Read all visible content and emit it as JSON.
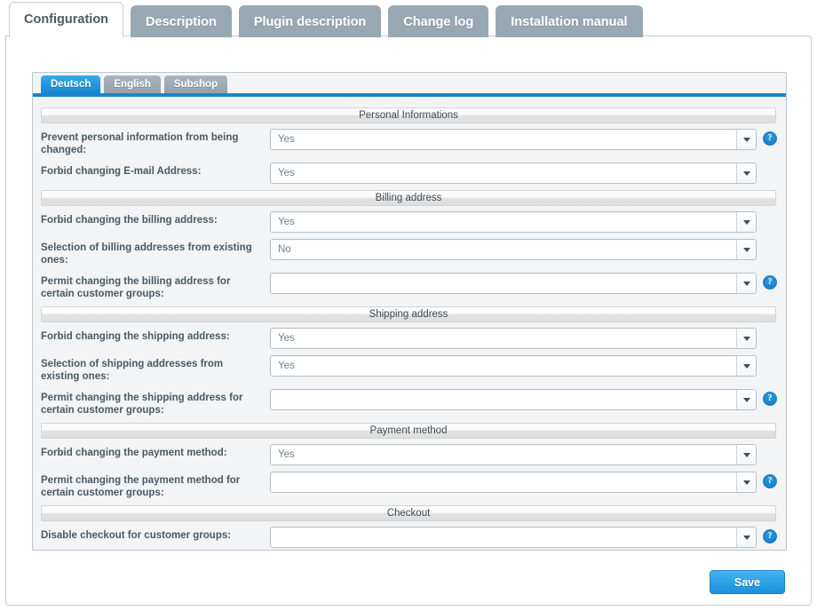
{
  "top_tabs": [
    {
      "label": "Configuration",
      "active": true
    },
    {
      "label": "Description",
      "active": false
    },
    {
      "label": "Plugin description",
      "active": false
    },
    {
      "label": "Change log",
      "active": false
    },
    {
      "label": "Installation manual",
      "active": false
    }
  ],
  "language_tabs": [
    {
      "label": "Deutsch",
      "active": true
    },
    {
      "label": "English",
      "active": false
    },
    {
      "label": "Subshop",
      "active": false
    }
  ],
  "help_glyph": "?",
  "sections": [
    {
      "title": "Personal Informations",
      "rows": [
        {
          "label": "Prevent personal information from being changed:",
          "value": "Yes",
          "help": true
        },
        {
          "label": "Forbid changing E-mail Address:",
          "value": "Yes",
          "help": false
        }
      ]
    },
    {
      "title": "Billing address",
      "rows": [
        {
          "label": "Forbid changing the billing address:",
          "value": "Yes",
          "help": false
        },
        {
          "label": "Selection of billing addresses from existing ones:",
          "value": "No",
          "help": false
        },
        {
          "label": "Permit changing the billing address for certain customer groups:",
          "value": "",
          "help": true
        }
      ]
    },
    {
      "title": "Shipping address",
      "rows": [
        {
          "label": "Forbid changing the shipping address:",
          "value": "Yes",
          "help": false
        },
        {
          "label": "Selection of shipping addresses from existing ones:",
          "value": "Yes",
          "help": false
        },
        {
          "label": "Permit changing the shipping address for certain customer groups:",
          "value": "",
          "help": true
        }
      ]
    },
    {
      "title": "Payment method",
      "rows": [
        {
          "label": "Forbid changing the payment method:",
          "value": "Yes",
          "help": false
        },
        {
          "label": "Permit changing the payment method for certain customer groups:",
          "value": "",
          "help": true
        }
      ]
    },
    {
      "title": "Checkout",
      "rows": [
        {
          "label": "Disable checkout for customer groups:",
          "value": "",
          "help": true
        }
      ]
    }
  ],
  "footer": {
    "save_label": "Save"
  },
  "colors": {
    "accent_blue": "#1b84cb",
    "tab_inactive": "#98a8b3",
    "label_text": "#4a5a66",
    "value_text": "#6e8294",
    "panel_bg": "#f2f4f5"
  }
}
